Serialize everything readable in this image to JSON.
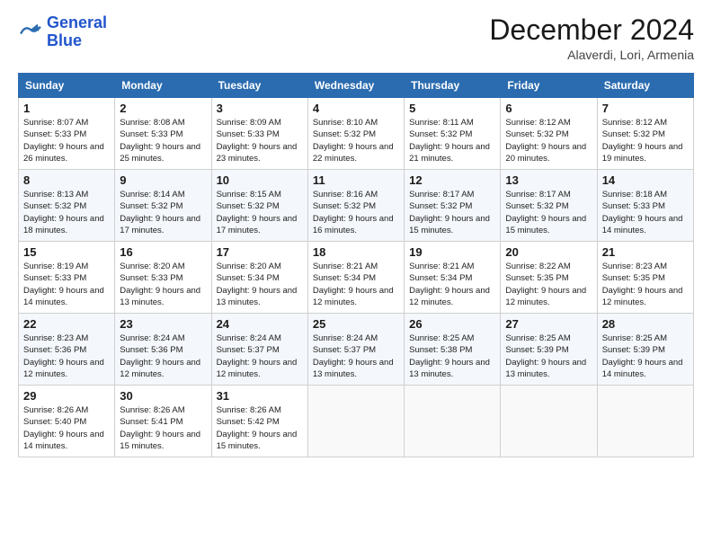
{
  "header": {
    "logo_line1": "General",
    "logo_line2": "Blue",
    "month_title": "December 2024",
    "subtitle": "Alaverdi, Lori, Armenia"
  },
  "weekdays": [
    "Sunday",
    "Monday",
    "Tuesday",
    "Wednesday",
    "Thursday",
    "Friday",
    "Saturday"
  ],
  "weeks": [
    [
      {
        "day": "1",
        "sunrise": "8:07 AM",
        "sunset": "5:33 PM",
        "daylight": "9 hours and 26 minutes."
      },
      {
        "day": "2",
        "sunrise": "8:08 AM",
        "sunset": "5:33 PM",
        "daylight": "9 hours and 25 minutes."
      },
      {
        "day": "3",
        "sunrise": "8:09 AM",
        "sunset": "5:33 PM",
        "daylight": "9 hours and 23 minutes."
      },
      {
        "day": "4",
        "sunrise": "8:10 AM",
        "sunset": "5:32 PM",
        "daylight": "9 hours and 22 minutes."
      },
      {
        "day": "5",
        "sunrise": "8:11 AM",
        "sunset": "5:32 PM",
        "daylight": "9 hours and 21 minutes."
      },
      {
        "day": "6",
        "sunrise": "8:12 AM",
        "sunset": "5:32 PM",
        "daylight": "9 hours and 20 minutes."
      },
      {
        "day": "7",
        "sunrise": "8:12 AM",
        "sunset": "5:32 PM",
        "daylight": "9 hours and 19 minutes."
      }
    ],
    [
      {
        "day": "8",
        "sunrise": "8:13 AM",
        "sunset": "5:32 PM",
        "daylight": "9 hours and 18 minutes."
      },
      {
        "day": "9",
        "sunrise": "8:14 AM",
        "sunset": "5:32 PM",
        "daylight": "9 hours and 17 minutes."
      },
      {
        "day": "10",
        "sunrise": "8:15 AM",
        "sunset": "5:32 PM",
        "daylight": "9 hours and 17 minutes."
      },
      {
        "day": "11",
        "sunrise": "8:16 AM",
        "sunset": "5:32 PM",
        "daylight": "9 hours and 16 minutes."
      },
      {
        "day": "12",
        "sunrise": "8:17 AM",
        "sunset": "5:32 PM",
        "daylight": "9 hours and 15 minutes."
      },
      {
        "day": "13",
        "sunrise": "8:17 AM",
        "sunset": "5:32 PM",
        "daylight": "9 hours and 15 minutes."
      },
      {
        "day": "14",
        "sunrise": "8:18 AM",
        "sunset": "5:33 PM",
        "daylight": "9 hours and 14 minutes."
      }
    ],
    [
      {
        "day": "15",
        "sunrise": "8:19 AM",
        "sunset": "5:33 PM",
        "daylight": "9 hours and 14 minutes."
      },
      {
        "day": "16",
        "sunrise": "8:20 AM",
        "sunset": "5:33 PM",
        "daylight": "9 hours and 13 minutes."
      },
      {
        "day": "17",
        "sunrise": "8:20 AM",
        "sunset": "5:34 PM",
        "daylight": "9 hours and 13 minutes."
      },
      {
        "day": "18",
        "sunrise": "8:21 AM",
        "sunset": "5:34 PM",
        "daylight": "9 hours and 12 minutes."
      },
      {
        "day": "19",
        "sunrise": "8:21 AM",
        "sunset": "5:34 PM",
        "daylight": "9 hours and 12 minutes."
      },
      {
        "day": "20",
        "sunrise": "8:22 AM",
        "sunset": "5:35 PM",
        "daylight": "9 hours and 12 minutes."
      },
      {
        "day": "21",
        "sunrise": "8:23 AM",
        "sunset": "5:35 PM",
        "daylight": "9 hours and 12 minutes."
      }
    ],
    [
      {
        "day": "22",
        "sunrise": "8:23 AM",
        "sunset": "5:36 PM",
        "daylight": "9 hours and 12 minutes."
      },
      {
        "day": "23",
        "sunrise": "8:24 AM",
        "sunset": "5:36 PM",
        "daylight": "9 hours and 12 minutes."
      },
      {
        "day": "24",
        "sunrise": "8:24 AM",
        "sunset": "5:37 PM",
        "daylight": "9 hours and 12 minutes."
      },
      {
        "day": "25",
        "sunrise": "8:24 AM",
        "sunset": "5:37 PM",
        "daylight": "9 hours and 13 minutes."
      },
      {
        "day": "26",
        "sunrise": "8:25 AM",
        "sunset": "5:38 PM",
        "daylight": "9 hours and 13 minutes."
      },
      {
        "day": "27",
        "sunrise": "8:25 AM",
        "sunset": "5:39 PM",
        "daylight": "9 hours and 13 minutes."
      },
      {
        "day": "28",
        "sunrise": "8:25 AM",
        "sunset": "5:39 PM",
        "daylight": "9 hours and 14 minutes."
      }
    ],
    [
      {
        "day": "29",
        "sunrise": "8:26 AM",
        "sunset": "5:40 PM",
        "daylight": "9 hours and 14 minutes."
      },
      {
        "day": "30",
        "sunrise": "8:26 AM",
        "sunset": "5:41 PM",
        "daylight": "9 hours and 15 minutes."
      },
      {
        "day": "31",
        "sunrise": "8:26 AM",
        "sunset": "5:42 PM",
        "daylight": "9 hours and 15 minutes."
      },
      null,
      null,
      null,
      null
    ]
  ]
}
